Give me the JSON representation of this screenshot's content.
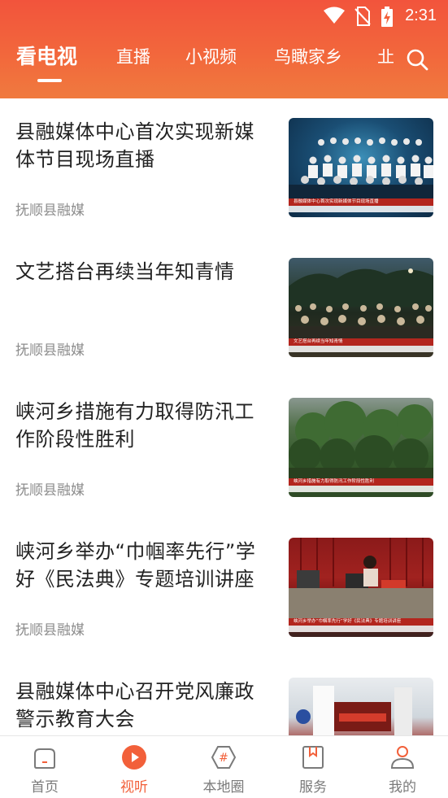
{
  "status_bar": {
    "time": "2:31",
    "icons": [
      "wifi-icon",
      "no-sim-icon",
      "battery-charging-icon"
    ]
  },
  "tabs": [
    {
      "label": "看电视",
      "active": true
    },
    {
      "label": "直播",
      "active": false
    },
    {
      "label": "小视频",
      "active": false
    },
    {
      "label": "鸟瞰家乡",
      "active": false
    },
    {
      "label": "㐀",
      "active": false
    }
  ],
  "header_icons": {
    "search": "search-icon"
  },
  "feed": {
    "items": [
      {
        "title": "县融媒体中心首次实现新媒体节目现场直播",
        "source": "抚顺县融媒",
        "thumb_caption": "县融媒体中心首次实现新媒体节目现场直播"
      },
      {
        "title": "文艺搭台再续当年知青情",
        "source": "抚顺县融媒",
        "thumb_caption": "文艺搭台再续当年知青情"
      },
      {
        "title": "峡河乡措施有力取得防汛工作阶段性胜利",
        "source": "抚顺县融媒",
        "thumb_caption": "峡河乡措施有力取得防汛工作阶段性胜利"
      },
      {
        "title": "峡河乡举办“巾帼率先行”学好《民法典》专题培训讲座",
        "source": "抚顺县融媒",
        "thumb_caption": "峡河乡举办“巾帼率先行”学好《民法典》专题培训讲座"
      },
      {
        "title": "县融媒体中心召开党风廉政警示教育大会",
        "source": "",
        "thumb_caption": ""
      }
    ]
  },
  "bottom_nav": {
    "items": [
      {
        "label": "首页",
        "icon": "home-icon",
        "active": false
      },
      {
        "label": "视听",
        "icon": "play-icon",
        "active": true
      },
      {
        "label": "本地圈",
        "icon": "hashtag-icon",
        "active": false
      },
      {
        "label": "服务",
        "icon": "bookmark-icon",
        "active": false
      },
      {
        "label": "我的",
        "icon": "user-icon",
        "active": false
      }
    ]
  },
  "colors": {
    "accent": "#f2603a",
    "header_gradient_top": "#f2543c",
    "header_gradient_bottom": "#f07a3e",
    "title_text": "#222222",
    "source_text": "#8d8d8d",
    "nav_inactive": "#7a7a7a"
  }
}
